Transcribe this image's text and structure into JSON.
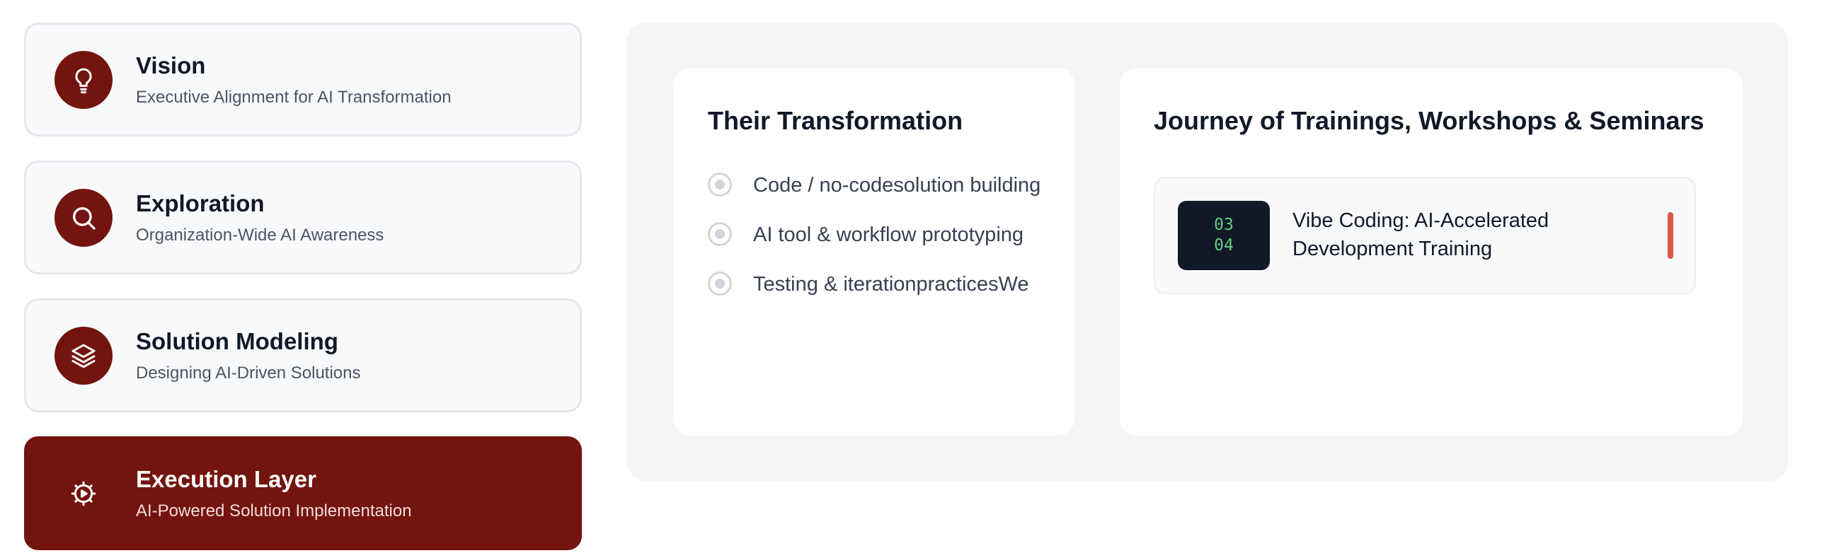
{
  "layers": [
    {
      "title": "Vision",
      "subtitle": "Executive Alignment for AI Transformation",
      "icon": "lightbulb-icon"
    },
    {
      "title": "Exploration",
      "subtitle": "Organization-Wide AI Awareness",
      "icon": "search-icon"
    },
    {
      "title": "Solution Modeling",
      "subtitle": "Designing AI-Driven Solutions",
      "icon": "layers-icon"
    },
    {
      "title": "Execution Layer",
      "subtitle": "AI-Powered Solution Implementation",
      "icon": "gear-play-icon",
      "active": true
    }
  ],
  "transformation": {
    "title": "Their Transformation",
    "items": [
      "Code / no-codesolution building",
      "AI tool & workflow prototyping",
      "Testing & iterationpracticesWe"
    ]
  },
  "journey": {
    "title": "Journey of Trainings, Workshops & Seminars",
    "trainings": [
      {
        "date_line1": "03",
        "date_line2": "04",
        "title": "Vibe Coding: AI-Accelerated Development Training"
      }
    ]
  },
  "colors": {
    "brand": "#73140e",
    "accent_bar": "#e0554d",
    "badge_text": "#5fcf80",
    "badge_bg": "#111827"
  }
}
